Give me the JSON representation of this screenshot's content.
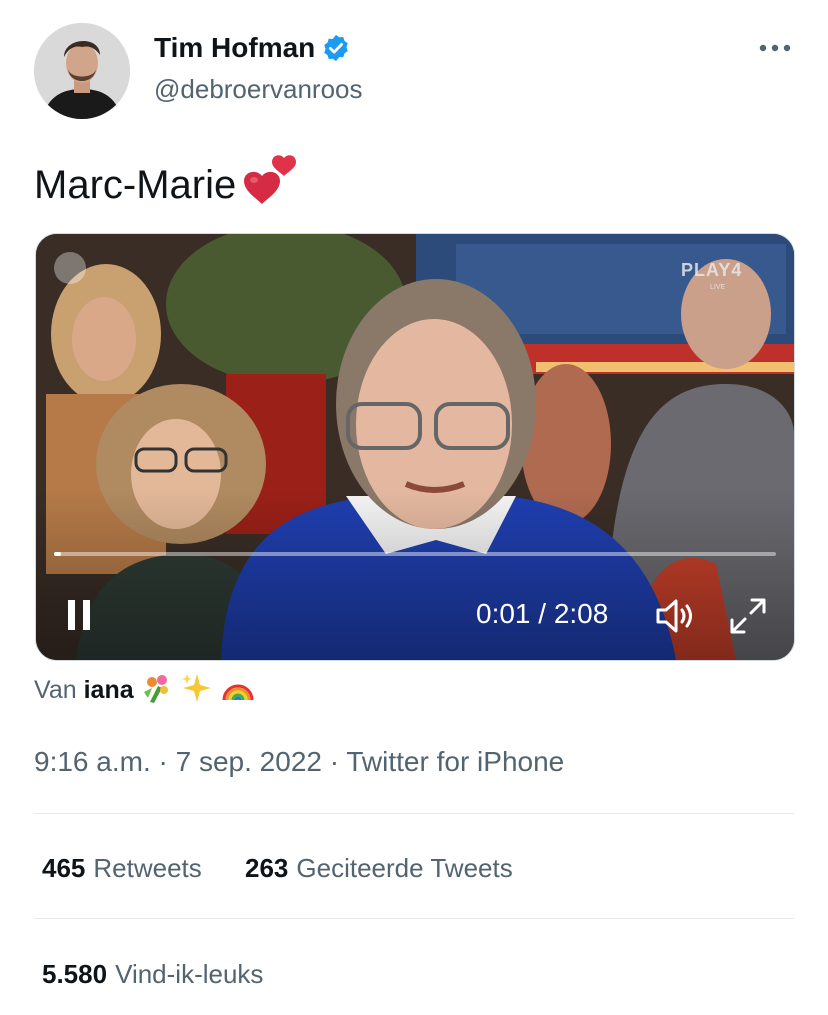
{
  "author": {
    "name": "Tim Hofman",
    "handle": "@debroervanroos",
    "verified": true,
    "avatar_icon": "profile-photo"
  },
  "tweet": {
    "text": "Marc-Marie",
    "emoji": "two-hearts"
  },
  "video": {
    "time": "0:01 / 2:08",
    "progress_fraction": 0.01,
    "channel_logo": "PLAY4",
    "channel_logo_sub": "LIVE",
    "controls": [
      "pause-icon",
      "volume-icon",
      "fullscreen-icon"
    ]
  },
  "source": {
    "prefix": "Van",
    "name": "iana",
    "emojis": [
      "bouquet",
      "sparkles",
      "rainbow"
    ]
  },
  "meta": {
    "time": "9:16 a.m.",
    "separator": "·",
    "date": "7 sep. 2022",
    "client": "Twitter for iPhone"
  },
  "stats": {
    "retweets_count": "465",
    "retweets_label": "Retweets",
    "quotes_count": "263",
    "quotes_label": "Geciteerde Tweets",
    "likes_count": "5.580",
    "likes_label": "Vind-ik-leuks"
  },
  "colors": {
    "text_primary": "#0f1419",
    "text_secondary": "#536471",
    "verified_blue": "#1d9bf0",
    "divider": "#e7e9ea",
    "heart_red": "#e0334a"
  }
}
